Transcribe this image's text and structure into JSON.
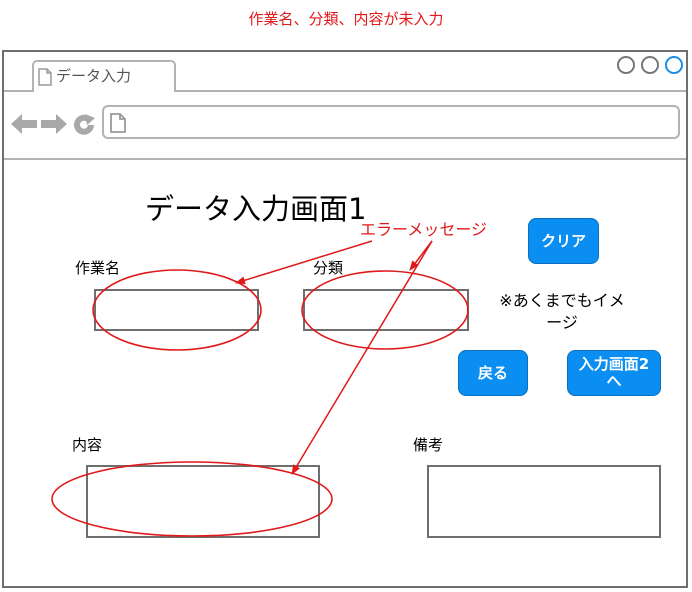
{
  "caption": "作業名、分類、内容が未入力",
  "browser": {
    "tab_label": "データ入力",
    "address_value": ""
  },
  "screen": {
    "title": "データ入力画面1",
    "fields": {
      "work_name_label": "作業名",
      "category_label": "分類",
      "content_label": "内容",
      "remarks_label": "備考"
    },
    "buttons": {
      "clear": "クリア",
      "back": "戻る",
      "next_line1": "入力画面2",
      "next_line2": "へ"
    },
    "note_line1": "※あくまでもイメ",
    "note_line2": "ージ"
  },
  "annotation": {
    "error_message_label": "エラーメッセージ",
    "color": "#e0191b"
  },
  "colors": {
    "button_blue": "#0b8ef2",
    "window_border": "#6e6e6e",
    "light_border": "#b3b3b3",
    "window_control_active": "#1a8ee8"
  },
  "icons": [
    "document-icon",
    "back-arrow-icon",
    "forward-arrow-icon",
    "reload-icon",
    "window-control-icon"
  ]
}
